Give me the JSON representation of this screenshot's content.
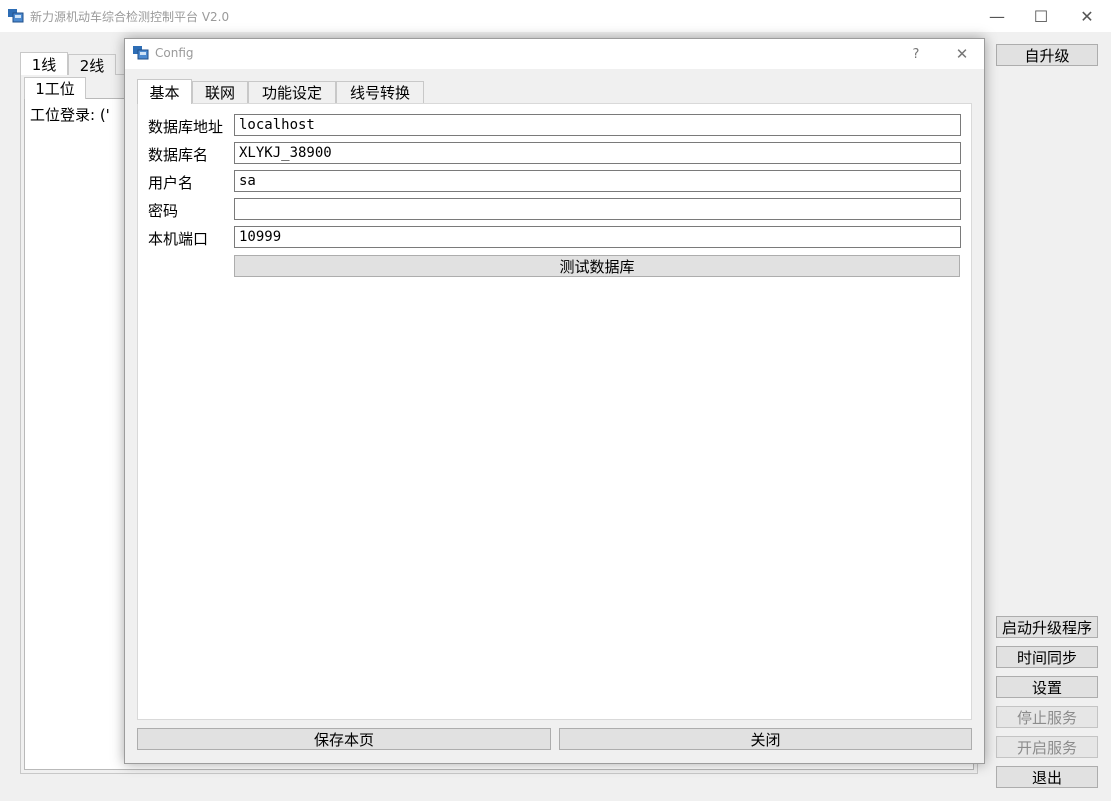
{
  "main_window": {
    "title": "新力源机动车综合检测控制平台 V2.0",
    "controls": {
      "minimize": "—",
      "maximize": "☐",
      "close": "✕"
    },
    "line_tabs": [
      "1线",
      "2线"
    ],
    "station_tabs": [
      "1工位"
    ],
    "login_text": "工位登录: ('",
    "side_buttons": {
      "self_upgrade": "自升级",
      "start_upgrade": "启动升级程序",
      "time_sync": "时间同步",
      "settings": "设置",
      "stop_service": "停止服务",
      "start_service": "开启服务",
      "exit": "退出"
    }
  },
  "dialog": {
    "title": "Config",
    "help": "?",
    "close": "✕",
    "tabs": [
      "基本",
      "联网",
      "功能设定",
      "线号转换"
    ],
    "fields": {
      "db_address": {
        "label": "数据库地址",
        "value": "localhost"
      },
      "db_name": {
        "label": "数据库名",
        "value": "XLYKJ_38900"
      },
      "username": {
        "label": "用户名",
        "value": "sa"
      },
      "password": {
        "label": "密码",
        "value": ""
      },
      "local_port": {
        "label": "本机端口",
        "value": "10999"
      }
    },
    "test_db_button": "测试数据库",
    "save_button": "保存本页",
    "close_button": "关闭"
  },
  "icons": {
    "app": "app-icon"
  }
}
